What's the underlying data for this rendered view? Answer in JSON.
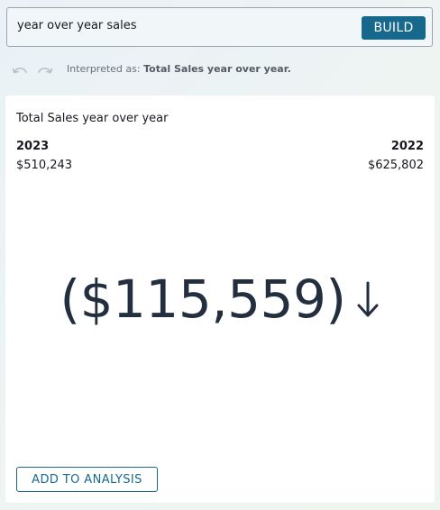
{
  "query": {
    "value": "year over year sales",
    "build_label": "BUILD"
  },
  "history": {
    "undo_icon": "undo-icon",
    "redo_icon": "redo-icon",
    "interpreted_prefix": "Interpreted as:",
    "interpreted_value": "Total Sales year over year."
  },
  "card": {
    "title": "Total Sales year over year",
    "current_period": {
      "label": "2023",
      "value": "$510,243"
    },
    "previous_period": {
      "label": "2022",
      "value": "$625,802"
    },
    "delta": "($115,559)",
    "delta_direction_icon": "down-arrow-icon",
    "add_label": "ADD TO ANALYSIS"
  },
  "colors": {
    "accent": "#17688d",
    "kpi_text": "#232f3e",
    "muted_text": "#687078",
    "disabled_icon": "#b7bec4"
  }
}
